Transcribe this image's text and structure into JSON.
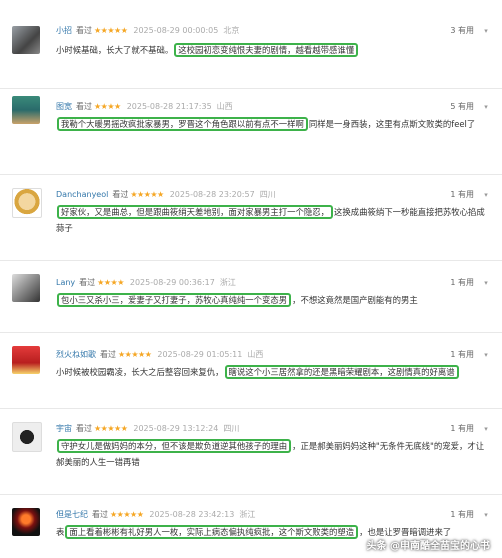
{
  "reviews": [
    {
      "user": "小招",
      "action": "看过",
      "stars": "★★★★★",
      "time": "2025-08-29 00:00:05",
      "location": "北京",
      "useful": "3 有用",
      "content_pre": "小时候基础，长大了就不基础。",
      "content_hl": "这校园初恋变纯恨夫妻的剧情，越看越带感谁懂",
      "content_post": ""
    },
    {
      "user": "图宽",
      "action": "看过",
      "stars": "★★★★",
      "time": "2025-08-28 21:17:35",
      "location": "山西",
      "useful": "5 有用",
      "content_pre": "",
      "content_hl": "我勒个大暖男摇改疯批家暴男，罗晋这个角色跟以前有点不一样啊",
      "content_post": "同样是一身西装，这里有点斯文败类的feel了"
    },
    {
      "user": "Danchanyeol",
      "action": "看过",
      "stars": "★★★★★",
      "time": "2025-08-28 23:20:57",
      "location": "四川",
      "useful": "1 有用",
      "content_pre": "",
      "content_hl": "好家伙，又是曲总，但是跟曲筱绡天差地别，面对家暴男主打一个隐忍，",
      "content_post": "这换成曲筱绡下一秒能直接把苏牧心掐成蒜子"
    },
    {
      "user": "Lany",
      "action": "看过",
      "stars": "★★★★",
      "time": "2025-08-29 00:36:17",
      "location": "浙江",
      "useful": "1 有用",
      "content_pre": "",
      "content_hl": "包小三又杀小三，爱妻子又打妻子，苏牧心真纯纯一个变态男",
      "content_post": "，不想这竟然是国产剧能有的男主"
    },
    {
      "user": "烈火ね如歌",
      "action": "看过",
      "stars": "★★★★★",
      "time": "2025-08-29 01:05:11",
      "location": "山西",
      "useful": "1 有用",
      "content_pre": "小时候被校园霸凌，长大之后整容回来复仇，",
      "content_hl": "瞎说这个小三居然拿的还是黑暗荣耀剧本，这剧情真的好离谱",
      "content_post": ""
    },
    {
      "user": "宇宙",
      "action": "看过",
      "stars": "★★★★★",
      "time": "2025-08-29 13:12:24",
      "location": "四川",
      "useful": "1 有用",
      "content_pre": "",
      "content_hl": "守护女儿是做妈妈的本分，但不该是欺负道逆其他孩子的理由",
      "content_post": "，正是郝美丽妈妈这种\"无条件无底线\"的宠爱，才让郝美丽的人生一错再错"
    },
    {
      "user": "但是七纪",
      "action": "看过",
      "stars": "★★★★★",
      "time": "2025-08-28 23:42:13",
      "location": "浙江",
      "useful": "1 有用",
      "content_pre": "表",
      "content_hl": "面上看着彬彬有礼好男人一枚，实际上病态偏执纯疯批，这个斯文败类的塑造",
      "content_post": "，也是让罗晋暗调进来了"
    }
  ],
  "watermark": "头条 @申南酷全苗宝的心书",
  "colors": {
    "highlight": "#3db24a",
    "username": "#3377aa",
    "stars": "#f5a623"
  }
}
